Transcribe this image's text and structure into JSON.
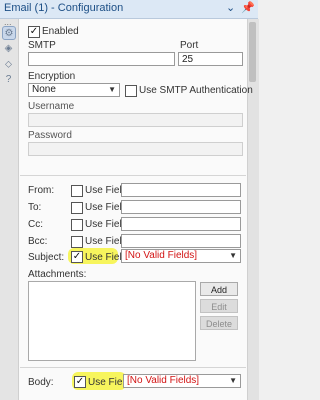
{
  "titlebar": {
    "title": "Email (1) - Configuration",
    "collapse_icon": "chevron-down",
    "pin_icon": "pin"
  },
  "sidebar": {
    "grip": "...",
    "icons": [
      "gear-icon",
      "connection-icon",
      "tag-icon",
      "help-icon"
    ]
  },
  "form": {
    "enabled_label": "Enabled",
    "enabled_checked": true,
    "smtp_label": "SMTP",
    "smtp_value": "",
    "port_label": "Port",
    "port_value": "25",
    "encryption_label": "Encryption",
    "encryption_value": "None",
    "smtp_auth_label": "Use SMTP Authentication",
    "username_label": "Username",
    "password_label": "Password"
  },
  "fields": [
    {
      "label": "From:",
      "use_field": "Use Field",
      "checked": false,
      "value": ""
    },
    {
      "label": "To:",
      "use_field": "Use Field",
      "checked": false,
      "value": ""
    },
    {
      "label": "Cc:",
      "use_field": "Use Field",
      "checked": false,
      "value": ""
    },
    {
      "label": "Bcc:",
      "use_field": "Use Field",
      "checked": false,
      "value": ""
    },
    {
      "label": "Subject:",
      "use_field": "Use Field",
      "checked": true,
      "value": "[No Valid Fields]"
    }
  ],
  "attachments": {
    "label": "Attachments:",
    "add": "Add",
    "edit": "Edit",
    "delete": "Delete"
  },
  "body": {
    "label": "Body:",
    "use_field": "Use Field",
    "checked": true,
    "value": "[No Valid Fields]"
  },
  "colors": {
    "highlight": "#f7f55d",
    "invalid_text": "#d21414",
    "titlebar_bg": "#dce8f5"
  }
}
